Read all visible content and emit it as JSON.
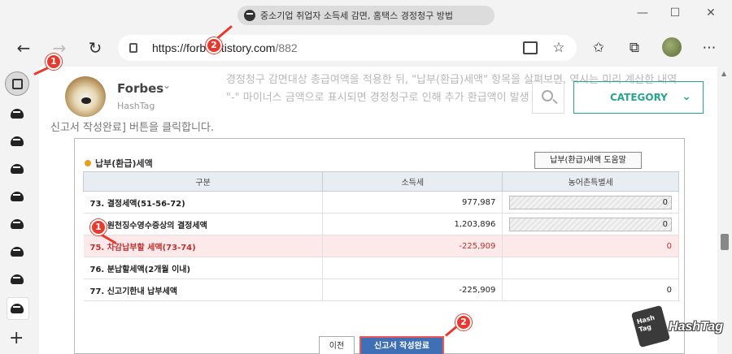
{
  "window": {
    "tab_title": "중소기업 취업자 소득세 감면, 홈택스 경정청구 방법",
    "minimize": "—",
    "maximize": "☐",
    "close": "✕"
  },
  "toolbar": {
    "url_domain": "https://forbes.tistory.com",
    "url_path": "/882"
  },
  "blog": {
    "name": "Forbes",
    "subtitle": "HashTag",
    "category_label": "CATEGORY",
    "bg_line1": "경정청구 감면대상 총급여액을 적용한 뒤, \"납부(환급)세액\" 항목을 살펴보면, 역시는 미리 계산한 내역",
    "bg_line2": "\"-\" 마이너스 금액으로 표시되면 경정청구로 인해 추가 환급액이 발생",
    "bg_line3": "신고서 작성완료] 버튼을 클릭합니다."
  },
  "tax_form": {
    "section_title": "납부(환급)세액",
    "help_button": "납부(환급)세액 도움말",
    "columns": [
      "구분",
      "소득세",
      "농어촌특별세"
    ],
    "rows": [
      {
        "label": "73. 결정세액(51-56-72)",
        "income_tax": "977,987",
        "rural_tax": "0"
      },
      {
        "label": "74. 원천징수영수증상의 결정세액",
        "income_tax": "1,203,896",
        "rural_tax": "0"
      },
      {
        "label": "75. 차감납부할 세액(73-74)",
        "income_tax": "-225,909",
        "rural_tax": "0"
      },
      {
        "label": "76. 분납할세액(2개월 이내)",
        "income_tax": "",
        "rural_tax": ""
      },
      {
        "label": "77. 신고기한내 납부세액",
        "income_tax": "-225,909",
        "rural_tax": "0"
      }
    ],
    "prev_button": "이전",
    "submit_button": "신고서 작성완료"
  },
  "markers": {
    "one": "1",
    "two": "2"
  },
  "watermark": {
    "logo_text": "Hash Tag",
    "text": "HashTag"
  },
  "colors": {
    "accent": "#2aa58e",
    "marker": "#e8392f",
    "highlight": "#fde9e9",
    "submit": "#3f6fb5"
  }
}
